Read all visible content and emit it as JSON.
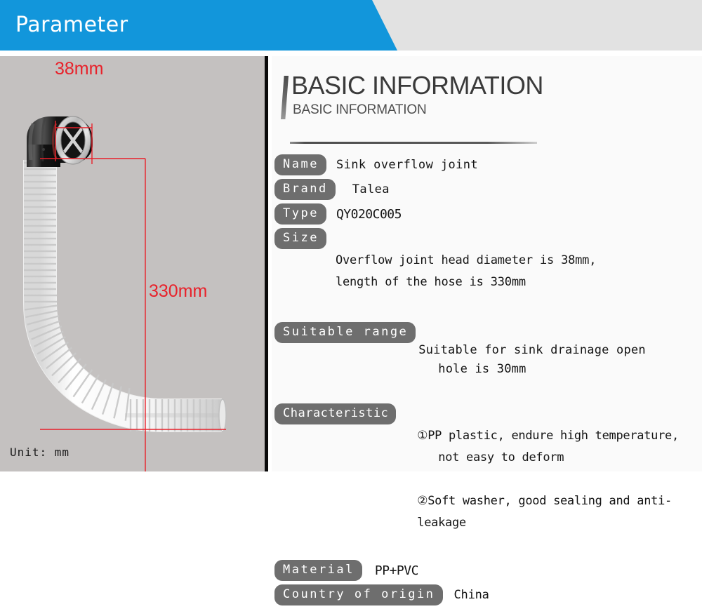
{
  "banner": {
    "title": "Parameter",
    "blue_color": "#1296db",
    "strip_color": "#e2e2e2"
  },
  "photo": {
    "panel_bg": "#c4c1c0",
    "unit_label": "Unit: mm",
    "annotations": [
      {
        "name": "diameter-dimension",
        "text": "38mm",
        "color": "#e8212a"
      },
      {
        "name": "length-dimension",
        "text": "330mm",
        "color": "#e8212a"
      }
    ],
    "product": {
      "elbow_color": "#1b1b1b",
      "chrome_color": "#d8d8d8",
      "hose_color": "#fbfbfb",
      "grate_shape": "x-cross"
    }
  },
  "info": {
    "title_main": "BASIC INFORMATION",
    "title_sub": "BASIC INFORMATION",
    "pill_color": "#6e6e6e",
    "specs": [
      {
        "label": "Name",
        "value": "Sink overflow joint"
      },
      {
        "label": "Brand",
        "value": "Talea"
      },
      {
        "label": "Type",
        "value": "QY020C005"
      },
      {
        "label": "Size",
        "value_line1": "Overflow joint head diameter is 38mm,",
        "value_line2": "length of the hose is 330mm"
      },
      {
        "label": "Suitable range",
        "value_line1": "Suitable for sink drainage open",
        "value_line2": "hole is 30mm"
      },
      {
        "label": "Characteristic",
        "value_line1": "①PP plastic, endure high temperature,",
        "value_line2": "not easy to deform",
        "value_line3": "②Soft washer, good sealing and anti-leakage"
      },
      {
        "label": "Material",
        "value": "PP+PVC"
      },
      {
        "label": "Country of origin",
        "value": "China"
      }
    ]
  }
}
